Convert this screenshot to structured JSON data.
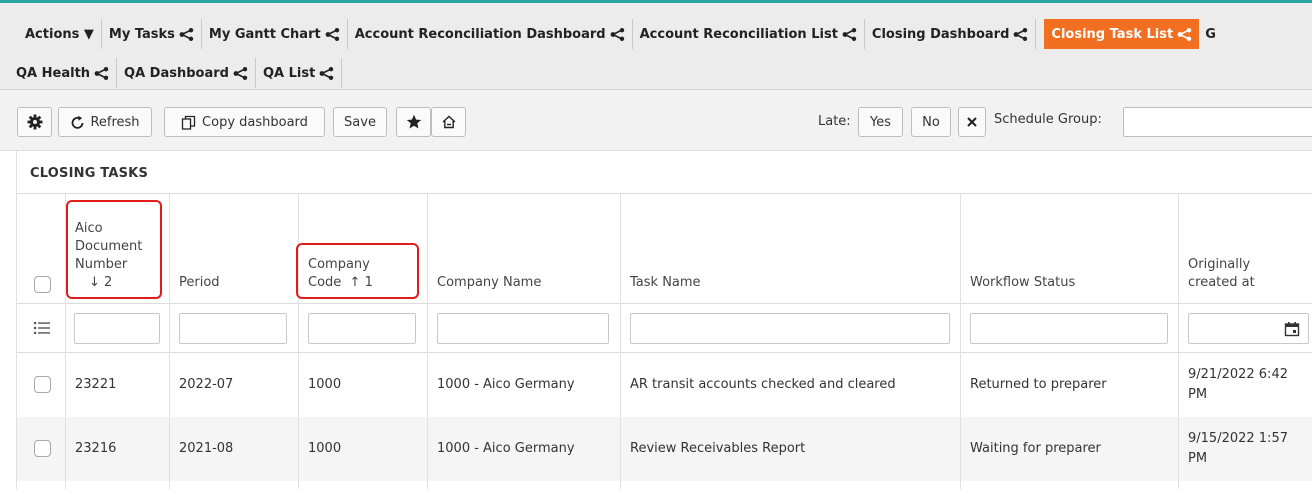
{
  "tabs": {
    "actions_label": "Actions ▼",
    "row1": [
      "My Tasks",
      "My Gantt Chart",
      "Account Reconciliation Dashboard",
      "Account Reconciliation List",
      "Closing Dashboard",
      "Closing Task List"
    ],
    "row1_partial": "G",
    "row2": [
      "QA Health",
      "QA Dashboard",
      "QA List"
    ]
  },
  "toolbar": {
    "refresh_label": "Refresh",
    "copy_label": "Copy dashboard",
    "save_label": "Save",
    "late_label": "Late:",
    "yes_label": "Yes",
    "no_label": "No",
    "schedule_group_label": "Schedule Group:",
    "schedule_group_value": ""
  },
  "section_title": "CLOSING TASKS",
  "table": {
    "headers": {
      "doc": [
        "Aico",
        "Document",
        "Number",
        "↓ 2"
      ],
      "period": "Period",
      "company_code": [
        "Company",
        "Code  ↑ 1"
      ],
      "company_name": "Company Name",
      "task_name": "Task Name",
      "workflow_status": "Workflow Status",
      "created_at": [
        "Originally",
        "created at"
      ]
    },
    "rows": [
      {
        "doc": "23221",
        "period": "2022-07",
        "code": "1000",
        "name": "1000 - Aico Germany",
        "task": "AR transit accounts checked and cleared",
        "status": "Returned to preparer",
        "created": "9/21/2022 6:42 PM"
      },
      {
        "doc": "23216",
        "period": "2021-08",
        "code": "1000",
        "name": "1000 - Aico Germany",
        "task": "Review Receivables Report",
        "status": "Waiting for preparer",
        "created": "9/15/2022 1:57 PM"
      }
    ]
  },
  "colors": {
    "active_tab": "#f26f21",
    "highlight": "#e21b1b",
    "accent_line": "#2aa7a0"
  }
}
